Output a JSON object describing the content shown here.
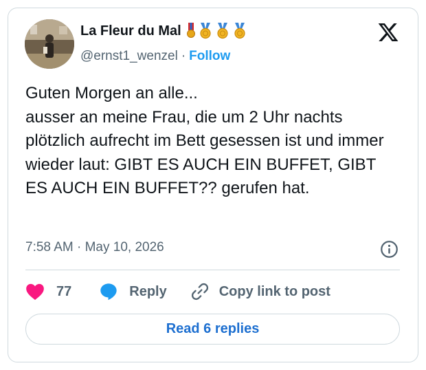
{
  "author": {
    "display_name": "La Fleur du Mal",
    "handle": "@ernst1_wenzel",
    "separator": "·",
    "follow_label": "Follow",
    "badges": [
      "medal-ribbon-icon",
      "medal-gold-icon",
      "medal-gold-icon",
      "medal-gold-icon"
    ]
  },
  "tweet": {
    "text": "Guten Morgen an alle...\nausser an meine Frau, die um 2 Uhr nachts plötzlich aufrecht im Bett gesessen ist und  immer wieder laut: GIBT ES AUCH EIN BUFFET,  GIBT ES AUCH EIN BUFFET?? gerufen hat.",
    "timestamp": "7:58 AM · May 10, 2026"
  },
  "actions": {
    "like_count": "77",
    "reply_label": "Reply",
    "copy_link_label": "Copy link to post"
  },
  "footer": {
    "read_replies_label": "Read 6 replies"
  },
  "colors": {
    "accent": "#1d9bf0",
    "like": "#f91880",
    "text": "#0f1419",
    "muted": "#536471",
    "border": "#cfd9de"
  }
}
